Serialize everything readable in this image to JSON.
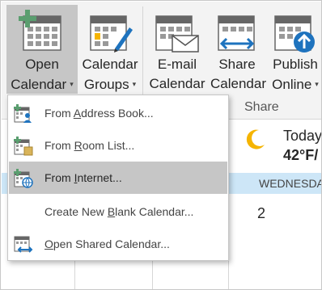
{
  "ribbon": {
    "open_calendar": {
      "line1": "Open",
      "line2": "Calendar"
    },
    "calendar_groups": {
      "line1": "Calendar",
      "line2": "Groups"
    },
    "email_calendar": {
      "line1": "E-mail",
      "line2": "Calendar"
    },
    "share_calendar": {
      "line1": "Share",
      "line2": "Calendar"
    },
    "publish_online": {
      "line1": "Publish",
      "line2": "Online"
    },
    "group_label": "Share",
    "caret": "▾"
  },
  "menu": {
    "items": [
      {
        "prefix": "From ",
        "accel": "A",
        "suffix": "ddress Book...",
        "icon": "address-book-calendar-icon"
      },
      {
        "prefix": "From ",
        "accel": "R",
        "suffix": "oom List...",
        "icon": "room-list-calendar-icon"
      },
      {
        "prefix": "From ",
        "accel": "I",
        "suffix": "nternet...",
        "icon": "internet-calendar-icon"
      },
      {
        "prefix": "Create New ",
        "accel": "B",
        "suffix": "lank Calendar...",
        "icon": ""
      },
      {
        "prefix": "",
        "accel": "O",
        "suffix": "pen Shared Calendar...",
        "icon": "shared-calendar-icon"
      }
    ],
    "highlighted_index": 2
  },
  "calendar": {
    "weather_title": "Today",
    "weather_temp": "42°F/",
    "day_header": "WEDNESDA",
    "date_number": "2"
  },
  "colors": {
    "ribbon_bg": "#f3f3f3",
    "pressed_bg": "#c6c6c6",
    "accent_green": "#5a9e6f",
    "accent_blue": "#1e73be",
    "day_header_bg": "#cde6f7",
    "moon": "#f5b400"
  }
}
